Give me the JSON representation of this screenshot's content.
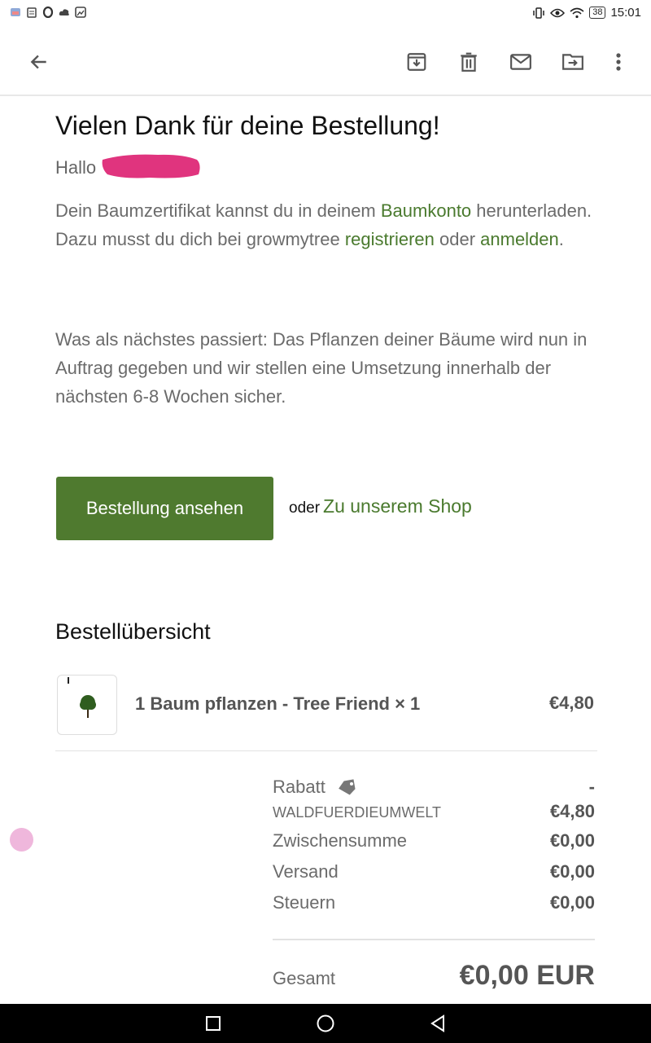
{
  "status_bar": {
    "time": "15:01",
    "battery": "38",
    "icons": [
      "notification-icon",
      "clipboard-icon",
      "opera-icon",
      "cloud-icon",
      "image-icon",
      "vibrate-icon",
      "eye-icon",
      "wifi-icon",
      "battery-icon"
    ]
  },
  "app_bar": {
    "icons": [
      "back-arrow-icon",
      "archive-icon",
      "delete-icon",
      "mail-icon",
      "move-to-folder-icon",
      "more-vert-icon"
    ]
  },
  "email": {
    "title": "Vielen Dank für deine Bestellung!",
    "greeting": "Hallo",
    "para1": {
      "t1": "Dein Baumzertifikat kannst du in deinem ",
      "link1": "Baumkonto",
      "t2": " herunterladen. Dazu musst du dich bei growmytree ",
      "link2": "registrieren",
      "t3": " oder ",
      "link3": "anmelden",
      "t4": "."
    },
    "para2": "Was als nächstes passiert: Das Pflanzen deiner Bäume wird nun in Auftrag gegeben und wir stellen eine Umsetzung innerhalb der nächsten 6-8 Wochen sicher.",
    "primary_button": "Bestellung ansehen",
    "or_text": "oder",
    "shop_link": "Zu unserem Shop",
    "summary_title": "Bestellübersicht",
    "item": {
      "name": "1 Baum pflanzen - Tree Friend × 1",
      "price": "€4,80"
    },
    "totals": {
      "discount_label": "Rabatt",
      "discount_dash": "-",
      "discount_code": "WALDFUERDIEUMWELT",
      "discount_value": "€4,80",
      "subtotal_label": "Zwischensumme",
      "subtotal_value": "€0,00",
      "shipping_label": "Versand",
      "shipping_value": "€0,00",
      "tax_label": "Steuern",
      "tax_value": "€0,00",
      "total_label": "Gesamt",
      "total_value": "€0,00 EUR"
    }
  },
  "colors": {
    "accent_green": "#4f7a2f",
    "link_green": "#4a7a2e",
    "redaction": "#e0347e"
  }
}
